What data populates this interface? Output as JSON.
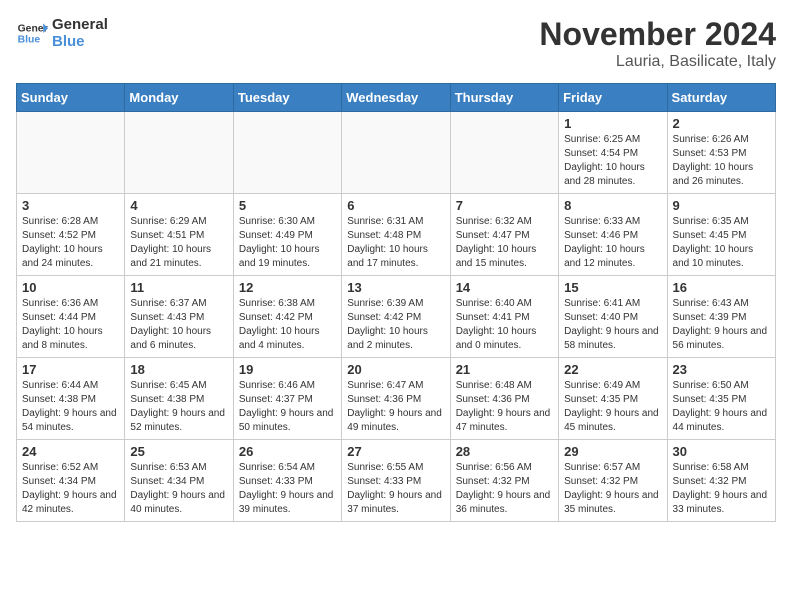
{
  "header": {
    "logo_line1": "General",
    "logo_line2": "Blue",
    "title": "November 2024",
    "subtitle": "Lauria, Basilicate, Italy"
  },
  "weekdays": [
    "Sunday",
    "Monday",
    "Tuesday",
    "Wednesday",
    "Thursday",
    "Friday",
    "Saturday"
  ],
  "weeks": [
    [
      {
        "day": "",
        "info": ""
      },
      {
        "day": "",
        "info": ""
      },
      {
        "day": "",
        "info": ""
      },
      {
        "day": "",
        "info": ""
      },
      {
        "day": "",
        "info": ""
      },
      {
        "day": "1",
        "info": "Sunrise: 6:25 AM\nSunset: 4:54 PM\nDaylight: 10 hours and 28 minutes."
      },
      {
        "day": "2",
        "info": "Sunrise: 6:26 AM\nSunset: 4:53 PM\nDaylight: 10 hours and 26 minutes."
      }
    ],
    [
      {
        "day": "3",
        "info": "Sunrise: 6:28 AM\nSunset: 4:52 PM\nDaylight: 10 hours and 24 minutes."
      },
      {
        "day": "4",
        "info": "Sunrise: 6:29 AM\nSunset: 4:51 PM\nDaylight: 10 hours and 21 minutes."
      },
      {
        "day": "5",
        "info": "Sunrise: 6:30 AM\nSunset: 4:49 PM\nDaylight: 10 hours and 19 minutes."
      },
      {
        "day": "6",
        "info": "Sunrise: 6:31 AM\nSunset: 4:48 PM\nDaylight: 10 hours and 17 minutes."
      },
      {
        "day": "7",
        "info": "Sunrise: 6:32 AM\nSunset: 4:47 PM\nDaylight: 10 hours and 15 minutes."
      },
      {
        "day": "8",
        "info": "Sunrise: 6:33 AM\nSunset: 4:46 PM\nDaylight: 10 hours and 12 minutes."
      },
      {
        "day": "9",
        "info": "Sunrise: 6:35 AM\nSunset: 4:45 PM\nDaylight: 10 hours and 10 minutes."
      }
    ],
    [
      {
        "day": "10",
        "info": "Sunrise: 6:36 AM\nSunset: 4:44 PM\nDaylight: 10 hours and 8 minutes."
      },
      {
        "day": "11",
        "info": "Sunrise: 6:37 AM\nSunset: 4:43 PM\nDaylight: 10 hours and 6 minutes."
      },
      {
        "day": "12",
        "info": "Sunrise: 6:38 AM\nSunset: 4:42 PM\nDaylight: 10 hours and 4 minutes."
      },
      {
        "day": "13",
        "info": "Sunrise: 6:39 AM\nSunset: 4:42 PM\nDaylight: 10 hours and 2 minutes."
      },
      {
        "day": "14",
        "info": "Sunrise: 6:40 AM\nSunset: 4:41 PM\nDaylight: 10 hours and 0 minutes."
      },
      {
        "day": "15",
        "info": "Sunrise: 6:41 AM\nSunset: 4:40 PM\nDaylight: 9 hours and 58 minutes."
      },
      {
        "day": "16",
        "info": "Sunrise: 6:43 AM\nSunset: 4:39 PM\nDaylight: 9 hours and 56 minutes."
      }
    ],
    [
      {
        "day": "17",
        "info": "Sunrise: 6:44 AM\nSunset: 4:38 PM\nDaylight: 9 hours and 54 minutes."
      },
      {
        "day": "18",
        "info": "Sunrise: 6:45 AM\nSunset: 4:38 PM\nDaylight: 9 hours and 52 minutes."
      },
      {
        "day": "19",
        "info": "Sunrise: 6:46 AM\nSunset: 4:37 PM\nDaylight: 9 hours and 50 minutes."
      },
      {
        "day": "20",
        "info": "Sunrise: 6:47 AM\nSunset: 4:36 PM\nDaylight: 9 hours and 49 minutes."
      },
      {
        "day": "21",
        "info": "Sunrise: 6:48 AM\nSunset: 4:36 PM\nDaylight: 9 hours and 47 minutes."
      },
      {
        "day": "22",
        "info": "Sunrise: 6:49 AM\nSunset: 4:35 PM\nDaylight: 9 hours and 45 minutes."
      },
      {
        "day": "23",
        "info": "Sunrise: 6:50 AM\nSunset: 4:35 PM\nDaylight: 9 hours and 44 minutes."
      }
    ],
    [
      {
        "day": "24",
        "info": "Sunrise: 6:52 AM\nSunset: 4:34 PM\nDaylight: 9 hours and 42 minutes."
      },
      {
        "day": "25",
        "info": "Sunrise: 6:53 AM\nSunset: 4:34 PM\nDaylight: 9 hours and 40 minutes."
      },
      {
        "day": "26",
        "info": "Sunrise: 6:54 AM\nSunset: 4:33 PM\nDaylight: 9 hours and 39 minutes."
      },
      {
        "day": "27",
        "info": "Sunrise: 6:55 AM\nSunset: 4:33 PM\nDaylight: 9 hours and 37 minutes."
      },
      {
        "day": "28",
        "info": "Sunrise: 6:56 AM\nSunset: 4:32 PM\nDaylight: 9 hours and 36 minutes."
      },
      {
        "day": "29",
        "info": "Sunrise: 6:57 AM\nSunset: 4:32 PM\nDaylight: 9 hours and 35 minutes."
      },
      {
        "day": "30",
        "info": "Sunrise: 6:58 AM\nSunset: 4:32 PM\nDaylight: 9 hours and 33 minutes."
      }
    ]
  ]
}
